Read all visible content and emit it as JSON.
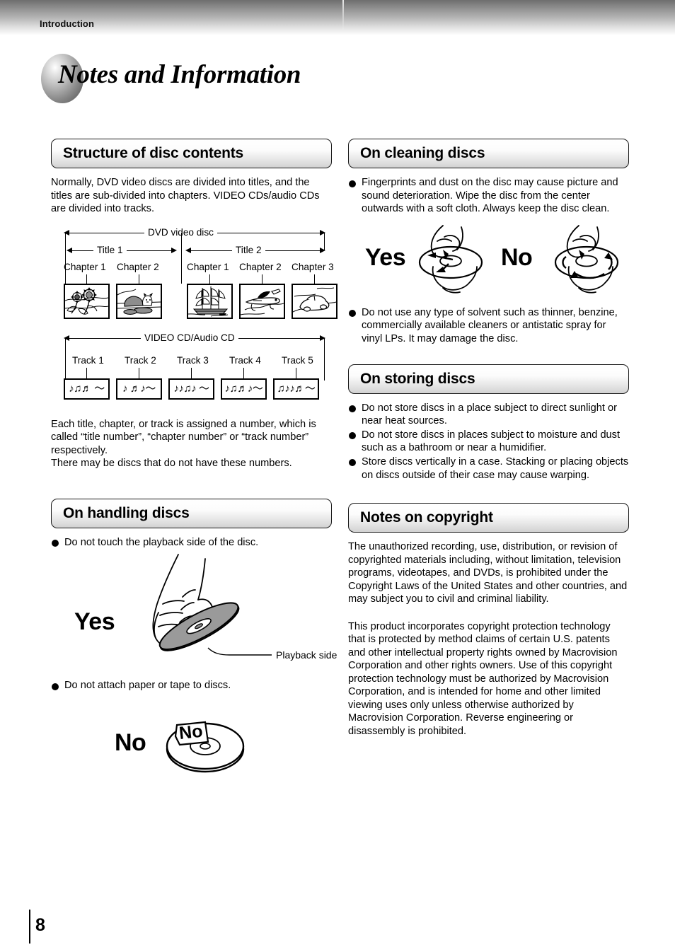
{
  "header": {
    "section_label": "Introduction"
  },
  "page_title": "Notes and Information",
  "page_number": "8",
  "left_column": {
    "structure": {
      "heading": "Structure of disc contents",
      "intro": "Normally, DVD video discs are divided into titles, and the titles are sub-divided into chapters. VIDEO CDs/audio CDs are divided into tracks.",
      "dvd_diagram": {
        "span_label": "DVD video disc",
        "titles": [
          {
            "label": "Title 1",
            "chapters": [
              "Chapter 1",
              "Chapter 2"
            ]
          },
          {
            "label": "Title 2",
            "chapters": [
              "Chapter 1",
              "Chapter 2",
              "Chapter 3"
            ]
          }
        ],
        "thumbnails": [
          "sunflowers",
          "cat",
          "sailing-ship",
          "airplane",
          "car"
        ]
      },
      "cd_diagram": {
        "span_label": "VIDEO CD/Audio CD",
        "tracks": [
          "Track 1",
          "Track 2",
          "Track 3",
          "Track 4",
          "Track 5"
        ],
        "track_glyphs": [
          "♪♫♬  〜",
          "♪ ♬♪〜",
          "♪♪♫♪ 〜",
          "♪♫♬♪〜",
          "♫♪♪♬〜"
        ]
      },
      "outro_1": "Each title, chapter, or track is assigned a number, which is called “title number”, “chapter number” or “track number” respectively.",
      "outro_2": "There may be discs that do not have these numbers."
    },
    "handling": {
      "heading": "On handling discs",
      "bullets": [
        "Do not touch the playback side of the disc.",
        "Do not attach paper or tape to discs."
      ],
      "yes_label": "Yes",
      "playback_side_label": "Playback side",
      "no_label": "No",
      "sticker_label": "No"
    }
  },
  "right_column": {
    "cleaning": {
      "heading": "On cleaning discs",
      "bullets": [
        "Fingerprints and dust on the disc may cause picture and sound deterioration. Wipe the disc from the center outwards with a soft cloth. Always keep the disc clean.",
        "Do not use any type of solvent such as thinner, benzine, commercially available cleaners or antistatic spray for vinyl LPs. It may damage the disc."
      ],
      "yes_label": "Yes",
      "no_label": "No"
    },
    "storing": {
      "heading": "On storing discs",
      "bullets": [
        "Do not store discs in a place subject to direct sunlight or near heat sources.",
        "Do not store discs in places subject to moisture and dust such as a bathroom or near a humidifier.",
        "Store discs vertically in a case. Stacking or placing objects on discs outside of their case may cause warping."
      ]
    },
    "copyright": {
      "heading": "Notes on copyright",
      "paragraph_1": "The unauthorized recording, use, distribution, or revision of copyrighted materials including, without limitation, television programs, videotapes, and DVDs, is prohibited under the Copyright Laws of the United States and other countries, and may subject you to civil and criminal liability.",
      "paragraph_2": "This product incorporates copyright protection technology that is protected by method claims of certain U.S. patents and other intellectual property rights owned by Macrovision Corporation and other rights owners. Use of this copyright protection technology must be authorized by Macrovision Corporation, and is intended for home and other limited viewing uses only unless otherwise authorized by Macrovision Corporation. Reverse engineering or disassembly is prohibited."
    }
  },
  "colors": {
    "ink": "#000000",
    "header_dark": "#6e6e6e",
    "pill_gradient_bottom": "#d2d2d2"
  }
}
